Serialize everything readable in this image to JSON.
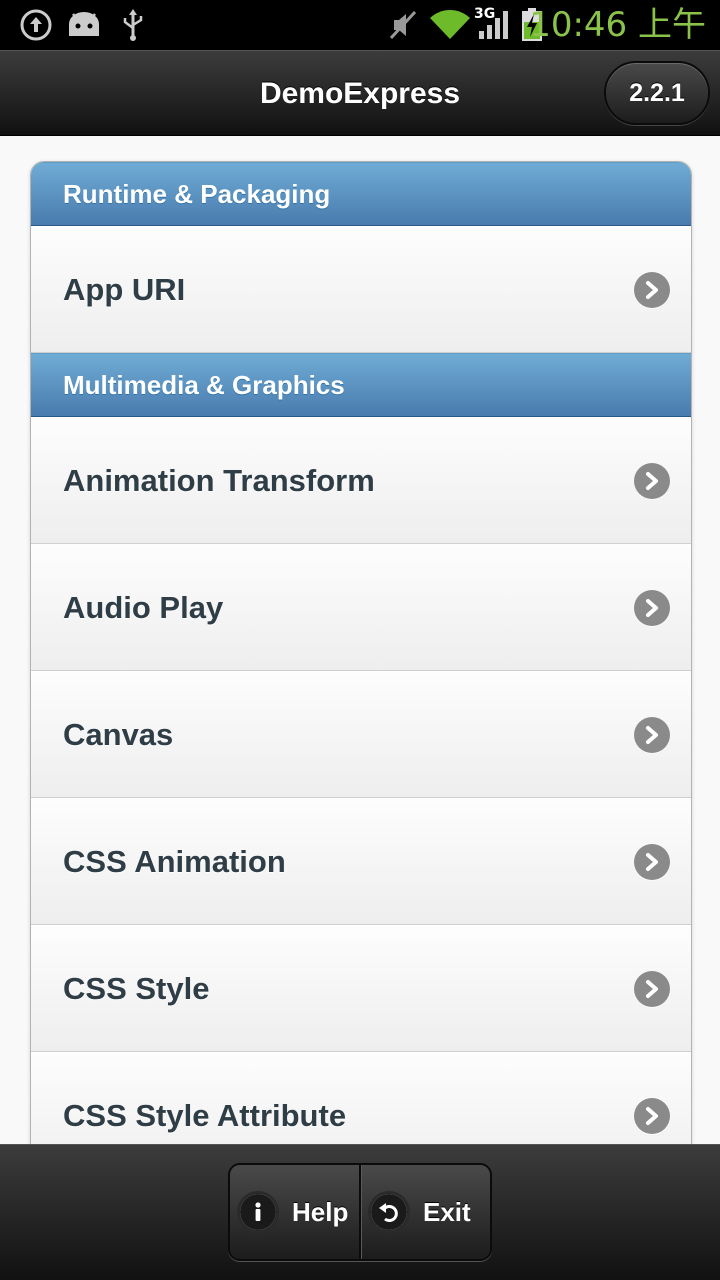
{
  "status_bar": {
    "time": "10:46 上午",
    "network_label": "3G",
    "left_icons": [
      "sync-icon",
      "android-icon",
      "usb-icon"
    ],
    "right_icons": [
      "mute-icon",
      "wifi-icon",
      "signal-icon",
      "battery-charging-icon"
    ],
    "time_color": "#8bc34a"
  },
  "header": {
    "title": "DemoExpress",
    "version_label": "2.2.1"
  },
  "list": [
    {
      "type": "divider",
      "label": "Runtime & Packaging"
    },
    {
      "type": "item",
      "label": "App URI"
    },
    {
      "type": "divider",
      "label": "Multimedia & Graphics"
    },
    {
      "type": "item",
      "label": "Animation Transform"
    },
    {
      "type": "item",
      "label": "Audio Play"
    },
    {
      "type": "item",
      "label": "Canvas"
    },
    {
      "type": "item",
      "label": "CSS Animation"
    },
    {
      "type": "item",
      "label": "CSS Style"
    },
    {
      "type": "item",
      "label": "CSS Style Attribute"
    }
  ],
  "footer": {
    "help_label": "Help",
    "exit_label": "Exit"
  },
  "colors": {
    "divider_blue": "#5e97c9",
    "chevron_gray": "#8a8a8a",
    "item_text": "#2f3e46"
  }
}
